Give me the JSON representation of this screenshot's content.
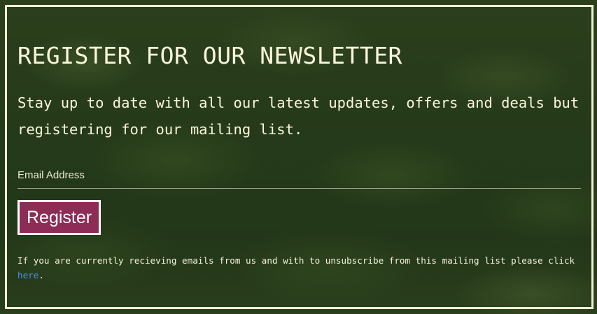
{
  "newsletter": {
    "title": "REGISTER FOR OUR NEWSLETTER",
    "description": "Stay up to date with all our latest updates, offers and deals but registering for our mailing list.",
    "email_placeholder": "Email Address",
    "email_value": "",
    "register_label": "Register",
    "unsubscribe_text": "If you are currently recieving emails from us and with to unsubscribe from this mailing list please click ",
    "unsubscribe_link": "here",
    "unsubscribe_end": "."
  },
  "colors": {
    "button_bg": "#8d2c55",
    "link": "#4d8fe6",
    "frame": "#f3f0d6",
    "text": "#fbf6dc"
  }
}
